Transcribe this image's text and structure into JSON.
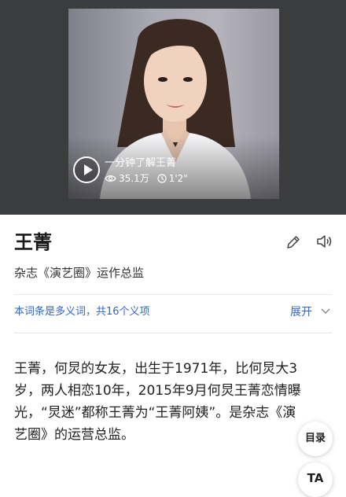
{
  "video": {
    "title": "一分钟了解王菁",
    "views": "35.1万",
    "duration": "1'2\""
  },
  "entry": {
    "name": "王菁",
    "subtitle": "杂志《演艺圈》运作总监"
  },
  "polysemy": {
    "note": "本词条是多义词，共16个义项",
    "expand_label": "展开"
  },
  "intro_lines": [
    "王菁，何炅的女友，出生于1971年，比何炅大3",
    "岁，两人相恋10年，2015年9月何炅王菁恋情曝",
    "光，“炅迷”都称王菁为“王菁阿姨”。是杂志《演",
    "艺圈》的运营总监。"
  ],
  "floating": {
    "toc_label": "目录",
    "ta_label": "TA"
  },
  "colors": {
    "hero_bg": "#3b3c3e",
    "link": "#3366cc",
    "text": "#222222"
  },
  "icons": [
    "play-icon",
    "eye-icon",
    "clock-icon",
    "edit-pencil-icon",
    "speaker-icon",
    "chevron-down-icon"
  ]
}
